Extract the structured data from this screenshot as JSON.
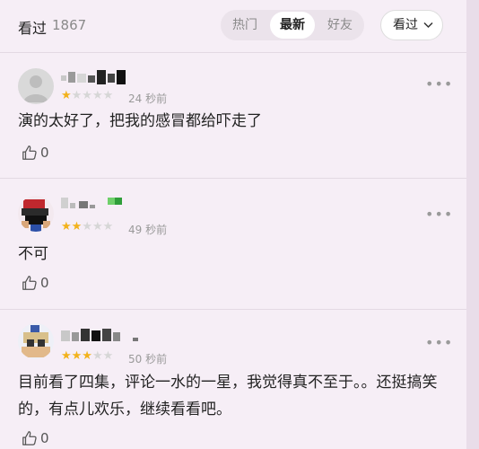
{
  "header": {
    "title_label": "看过",
    "title_count": "1867",
    "tabs": [
      {
        "label": "热门",
        "active": false
      },
      {
        "label": "最新",
        "active": true
      },
      {
        "label": "好友",
        "active": false
      }
    ],
    "filter_label": "看过"
  },
  "comments": [
    {
      "rating": 1,
      "time": "24 秒前",
      "text": "演的太好了，把我的感冒都给吓走了",
      "likes": "0"
    },
    {
      "rating": 2,
      "time": "49 秒前",
      "text": "不可",
      "likes": "0"
    },
    {
      "rating": 3,
      "time": "50 秒前",
      "text": "目前看了四集，评论一水的一星，我觉得真不至于。。还挺搞笑的，有点儿欢乐，继续看看吧。",
      "likes": "0"
    }
  ],
  "colors": {
    "star_on": "#f2b21c",
    "star_off": "#d6d6d6",
    "background": "#f6eef6"
  },
  "icons": [
    "chevron-down-icon",
    "more-icon",
    "thumbs-up-icon"
  ]
}
